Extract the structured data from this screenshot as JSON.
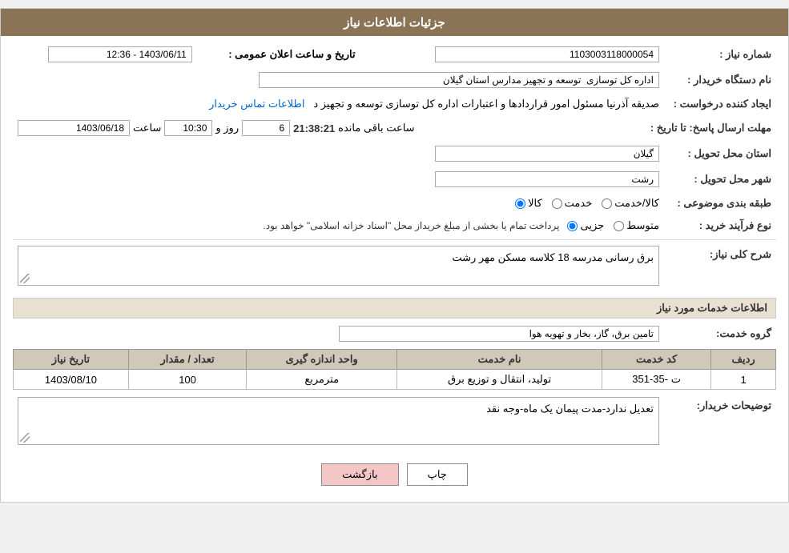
{
  "header": {
    "title": "جزئیات اطلاعات نیاز"
  },
  "fields": {
    "shomara_niaz_label": "شماره نیاز :",
    "shomara_niaz_value": "1103003118000054",
    "nam_dastgah_label": "نام دستگاه خریدار :",
    "nam_dastgah_value": "اداره کل توسازی  توسعه و تجهیز مدارس استان گیلان",
    "ejad_konande_label": "ایجاد کننده درخواست :",
    "ejad_konande_value": "صدیقه آذرنیا مسئول امور قراردادها و اعتبارات اداره کل توسازی  توسعه و تجهیز د",
    "ejad_konande_link": "اطلاعات تماس خریدار",
    "mohlat_ersal_label": "مهلت ارسال پاسخ: تا تاریخ :",
    "date_value": "1403/06/18",
    "saat_label": "ساعت",
    "saat_value": "10:30",
    "rooz_label": "روز و",
    "rooz_value": "6",
    "baqi_saat_label": "ساعت باقی مانده",
    "baqi_saat_value": "21:38:21",
    "ostan_label": "استان محل تحویل :",
    "ostan_value": "گیلان",
    "shahr_label": "شهر محل تحویل :",
    "shahr_value": "رشت",
    "tabaqe_bandi_label": "طبقه بندی موضوعی :",
    "tabaqe_options": [
      {
        "label": "کالا",
        "value": "kala"
      },
      {
        "label": "خدمت",
        "value": "khedmat"
      },
      {
        "label": "کالا/خدمت",
        "value": "kala_khedmat"
      }
    ],
    "tabaqe_selected": "kala",
    "nooe_farayand_label": "نوع فرآیند خرید :",
    "nooe_options": [
      {
        "label": "جزیی",
        "value": "jozi"
      },
      {
        "label": "متوسط",
        "value": "motavaset"
      }
    ],
    "nooe_selected": "jozi",
    "nooe_description": "پرداخت تمام یا بخشی از مبلغ خریداز محل \"اسناد خزانه اسلامی\" خواهد بود.",
    "sharh_label": "شرح کلی نیاز:",
    "sharh_value": "برق رسانی مدرسه 18 کلاسه مسکن مهر رشت",
    "khadamat_section_title": "اطلاعات خدمات مورد نیاز",
    "grooh_label": "گروه خدمت:",
    "grooh_value": "تامین برق، گاز، بخار و تهویه هوا",
    "table": {
      "headers": [
        "ردیف",
        "کد خدمت",
        "نام خدمت",
        "واحد اندازه گیری",
        "تعداد / مقدار",
        "تاریخ نیاز"
      ],
      "rows": [
        {
          "radif": "1",
          "kod": "ت -35-351",
          "naam": "تولید، انتقال و توزیع برق",
          "vahed": "مترمربع",
          "tedad": "100",
          "tarikh": "1403/08/10"
        }
      ]
    },
    "tosif_label": "توضیحات خریدار:",
    "tosif_value": "تعدیل ندارد-مدت پیمان یک ماه-وجه نقد",
    "tarikh_aalan_label": "تاریخ و ساعت اعلان عمومی :",
    "tarikh_aalan_value": "1403/06/11 - 12:36"
  },
  "buttons": {
    "print_label": "چاپ",
    "back_label": "بازگشت"
  }
}
